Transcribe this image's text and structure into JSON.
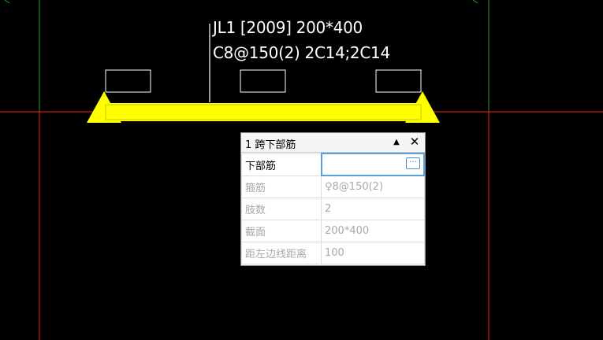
{
  "annotation": {
    "line1": "JL1 [2009] 200*400",
    "line2": "C8@150(2) 2C14;2C14"
  },
  "colors": {
    "background": "#000000",
    "axis_red": "#ff1f1f",
    "axis_green": "#1aa51a",
    "beam_fill": "#ffff00",
    "support_fill": "#ffff00",
    "outline_white": "#ffffff"
  },
  "panel": {
    "title": "1 跨下部筋",
    "collapse_icon": "triangle-up-icon",
    "close_icon": "close-icon",
    "rows": [
      {
        "name": "下部筋",
        "value": "",
        "active": true,
        "button_label": "···"
      },
      {
        "name": "箍筋",
        "value": "♀8@150(2)",
        "active": false
      },
      {
        "name": "肢数",
        "value": "2",
        "active": false
      },
      {
        "name": "截面",
        "value": "200*400",
        "active": false
      },
      {
        "name": "距左边线距离",
        "value": "100",
        "active": false
      }
    ]
  }
}
